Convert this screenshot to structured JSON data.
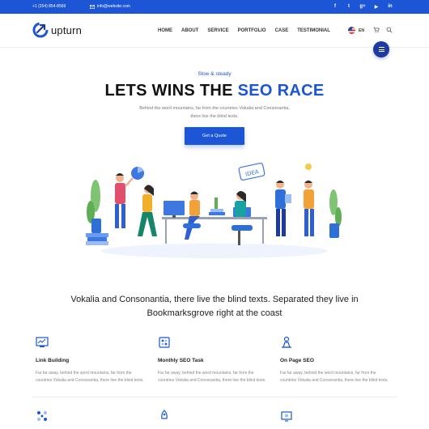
{
  "topbar": {
    "phone": "+1 (254) 854-8569",
    "email": "info@website.com",
    "socials": [
      {
        "icon": "facebook-icon",
        "glyph": "f"
      },
      {
        "icon": "twitter-icon",
        "glyph": "t"
      },
      {
        "icon": "google-plus-icon",
        "glyph": "g+"
      },
      {
        "icon": "youtube-icon",
        "glyph": "▶"
      },
      {
        "icon": "linkedin-icon",
        "glyph": "in"
      }
    ]
  },
  "nav": {
    "logo_text": "upturn",
    "menu": [
      "HOME",
      "ABOUT",
      "SERVICE",
      "PORTFOLIO",
      "CASE",
      "TESTIMONIAL"
    ],
    "language": "EN"
  },
  "hero": {
    "kicker": "Slow & steady",
    "title_main": "LETS WINS THE ",
    "title_accent": "SEO RACE",
    "description": "Behind the word mountains, far from the countries Vokalia and Consonantia, there live the blind texts.",
    "cta_label": "Get a Quote",
    "illustration_sign": "IDEA"
  },
  "section": {
    "heading": "Vokalia and Consonantia, there live the blind texts. Separated they live in Bookmarksgrove right at the coast"
  },
  "features": [
    {
      "icon": "link-building-icon",
      "title": "Link Building",
      "description": "Far far away, behind the word mountains, far from the countries Vokalia and Consonantia, there live the blind texts."
    },
    {
      "icon": "monthly-seo-task-icon",
      "title": "Monthly SEO Task",
      "description": "Far far away, behind the word mountains, far from the countries Vokalia and Consonantia, there live the blind texts."
    },
    {
      "icon": "on-page-seo-icon",
      "title": "On Page SEO",
      "description": "Far far away, behind the word mountains, far from the countries Vokalia and Consonantia, there live the blind texts."
    }
  ],
  "colors": {
    "brand": "#1c56d6",
    "dark_brand": "#1c3aa0",
    "text": "#222222",
    "muted": "#888888"
  }
}
